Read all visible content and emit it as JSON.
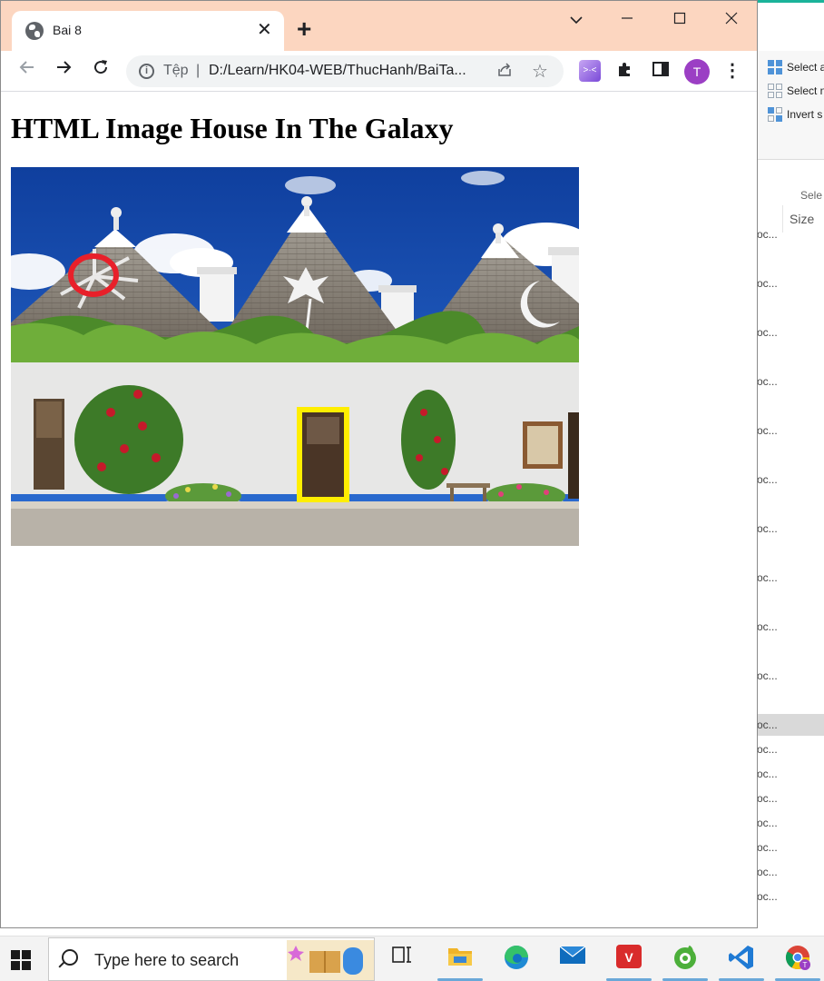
{
  "browser": {
    "tab_title": "Bai 8",
    "close_tab_symbol": "✕",
    "new_tab_symbol": "+",
    "url_scheme": "Tệp",
    "url_separator": "|",
    "url": "D:/Learn/HK04-WEB/ThucHanh/BaiTa...",
    "profile_initial": "T",
    "accent_color": "#fcd6c0",
    "profile_color": "#9b3fc4",
    "icons": [
      "globe-icon",
      "close-icon",
      "plus-icon",
      "chevron-down-icon",
      "minimize-icon",
      "maximize-icon",
      "back-arrow-icon",
      "forward-arrow-icon",
      "reload-icon",
      "info-icon",
      "share-icon",
      "star-icon",
      "puzzle-icon",
      "sidepanel-icon",
      "more-vert-icon"
    ]
  },
  "page": {
    "heading": "HTML Image House In The Galaxy",
    "image_description_colors": {
      "circle": "#e8202a",
      "rectangle": "#ffee00"
    }
  },
  "explorer": {
    "ribbon_items": [
      "Select a",
      "Select n",
      "Invert s"
    ],
    "group_label": "Sele",
    "column_header": "Size",
    "file_rows": [
      "oc...",
      "oc...",
      "oc...",
      "oc...",
      "oc...",
      "oc...",
      "oc...",
      "oc...",
      "oc...",
      "oc...",
      "oc...",
      "oc...",
      "oc...",
      "oc...",
      "oc...",
      "oc...",
      "oc...",
      "oc..."
    ]
  },
  "taskbar": {
    "search_placeholder": "Type here to search",
    "apps": [
      "task-view-icon",
      "file-explorer-icon",
      "edge-icon",
      "mail-icon",
      "vba-icon",
      "coccoc-icon",
      "vscode-icon",
      "chrome-icon"
    ]
  }
}
